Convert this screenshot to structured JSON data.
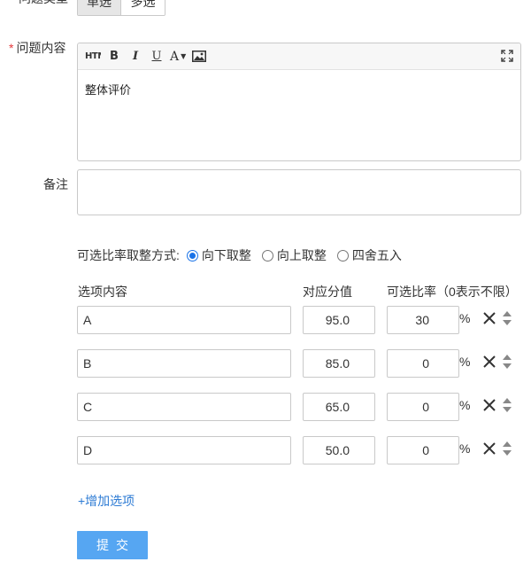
{
  "question_type": {
    "label": "问题类型",
    "options": [
      "单选",
      "多选"
    ],
    "selected": "单选"
  },
  "content": {
    "required_mark": "*",
    "label": "问题内容",
    "toolbar": {
      "html": "HTML",
      "bold": "B",
      "italic": "I",
      "underline": "U",
      "font": "A"
    },
    "value": "整体评价"
  },
  "remark": {
    "label": "备注",
    "value": ""
  },
  "rounding": {
    "label": "可选比率取整方式:",
    "options": [
      "向下取整",
      "向上取整",
      "四舍五入"
    ],
    "selected": "向下取整"
  },
  "options_table": {
    "headers": {
      "content": "选项内容",
      "score": "对应分值",
      "rate": "可选比率（0表示不限）"
    },
    "percent_sign": "%",
    "rows": [
      {
        "text": "A",
        "score": "95.0",
        "rate": "30"
      },
      {
        "text": "B",
        "score": "85.0",
        "rate": "0"
      },
      {
        "text": "C",
        "score": "65.0",
        "rate": "0"
      },
      {
        "text": "D",
        "score": "50.0",
        "rate": "0"
      }
    ]
  },
  "add_option_label": "+增加选项",
  "submit_label": "提交",
  "colors": {
    "accent": "#1a73e8",
    "link": "#2d7bd4",
    "submit_bg": "#56a6f2",
    "required": "#e4393c"
  }
}
